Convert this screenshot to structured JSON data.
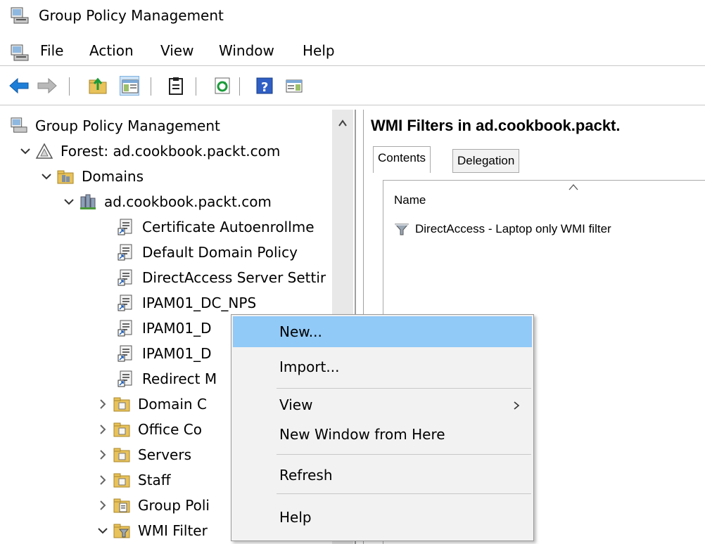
{
  "window": {
    "title": "Group Policy Management"
  },
  "menu": [
    "File",
    "Action",
    "View",
    "Window",
    "Help"
  ],
  "tree": [
    {
      "label": "Group Policy Management",
      "chev": "",
      "icon": "gpm"
    },
    {
      "label": "Forest: ad.cookbook.packt.com",
      "chev": "down",
      "icon": "forest"
    },
    {
      "label": "Domains",
      "chev": "down",
      "icon": "domains"
    },
    {
      "label": "ad.cookbook.packt.com",
      "chev": "down",
      "icon": "domain"
    },
    {
      "label": "Certificate Autoenrollme",
      "chev": "",
      "icon": "gpo-link"
    },
    {
      "label": "Default Domain Policy",
      "chev": "",
      "icon": "gpo-link"
    },
    {
      "label": "DirectAccess Server Settir",
      "chev": "",
      "icon": "gpo-link"
    },
    {
      "label": "IPAM01_DC_NPS",
      "chev": "",
      "icon": "gpo-link"
    },
    {
      "label": "IPAM01_D",
      "chev": "",
      "icon": "gpo-link"
    },
    {
      "label": "IPAM01_D",
      "chev": "",
      "icon": "gpo-link"
    },
    {
      "label": "Redirect M",
      "chev": "",
      "icon": "gpo-link"
    },
    {
      "label": "Domain C",
      "chev": "right",
      "icon": "ou"
    },
    {
      "label": "Office Co",
      "chev": "right",
      "icon": "ou"
    },
    {
      "label": "Servers",
      "chev": "right",
      "icon": "ou"
    },
    {
      "label": "Staff",
      "chev": "right",
      "icon": "ou"
    },
    {
      "label": "Group Poli",
      "chev": "right",
      "icon": "gpo-folder"
    },
    {
      "label": "WMI Filter",
      "chev": "down",
      "icon": "wmi-folder"
    }
  ],
  "right_pane": {
    "title": "WMI Filters in ad.cookbook.packt.",
    "tabs": [
      "Contents",
      "Delegation"
    ],
    "column_header": "Name",
    "items": [
      "DirectAccess - Laptop only WMI filter"
    ]
  },
  "context_menu": {
    "items": [
      "New...",
      "Import...",
      "View",
      "New Window from Here",
      "Refresh",
      "Help"
    ],
    "highlighted": "New..."
  },
  "colors": {
    "highlight": "#91c9f7",
    "menu_bg": "#f2f2f2",
    "back_arrow": "#1e7fd8",
    "folder": "#e8c25a"
  }
}
